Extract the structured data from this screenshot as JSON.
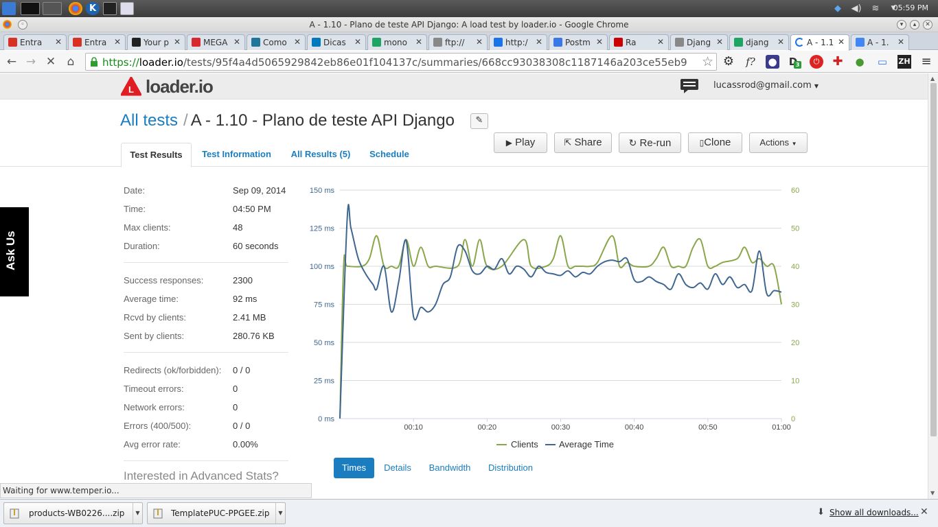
{
  "os": {
    "clock": "05:59 PM"
  },
  "window": {
    "title": "A - 1.10 - Plano de teste API Django: A load test by loader.io - Google Chrome"
  },
  "tabs": [
    {
      "label": "Entra",
      "favicon": "gmail-icon",
      "color": "#d93025"
    },
    {
      "label": "Entra",
      "favicon": "gmail-icon",
      "color": "#d93025"
    },
    {
      "label": "Your p",
      "favicon": "w-icon",
      "color": "#222222"
    },
    {
      "label": "MEGA",
      "favicon": "mega-icon",
      "color": "#d9272e"
    },
    {
      "label": "Como",
      "favicon": "wordpress-icon",
      "color": "#21759b"
    },
    {
      "label": "Dicas",
      "favicon": "trello-icon",
      "color": "#0079bf"
    },
    {
      "label": "mono",
      "favicon": "drive-icon",
      "color": "#1fa463"
    },
    {
      "label": "ftp://",
      "favicon": "page-icon",
      "color": "#888888"
    },
    {
      "label": "http:/",
      "favicon": "arrows-icon",
      "color": "#1a73e8"
    },
    {
      "label": "Postm",
      "favicon": "globe-icon",
      "color": "#3b78e7"
    },
    {
      "label": "Ra",
      "favicon": "youtube-icon",
      "color": "#cc0000"
    },
    {
      "label": "Djang",
      "favicon": "page-icon",
      "color": "#888888"
    },
    {
      "label": "djang",
      "favicon": "drive-icon",
      "color": "#1fa463"
    },
    {
      "label": "A - 1.1",
      "favicon": "loading-icon",
      "color": "#1a73e8"
    },
    {
      "label": "A - 1.",
      "favicon": "docs-icon",
      "color": "#4285f4"
    }
  ],
  "toolbar": {
    "url_protocol": "https://",
    "url_host": "loader.io",
    "url_path": "/tests/95f4a4d5065929842eb86e01f104137c/summaries/668cc93038308c1187146a203ce55eb9",
    "ext_zh": "ZH",
    "ext_f": "f?",
    "ext_d_badge": "3"
  },
  "header": {
    "logo": "loader.io",
    "user": "lucassrod@gmail.com"
  },
  "breadcrumb": {
    "all_tests": "All tests",
    "separator": "/",
    "test_name": "A - 1.10 - Plano de teste API Django"
  },
  "actions": {
    "play": "Play",
    "share": "Share",
    "rerun": "Re-run",
    "clone": "Clone",
    "actions": "Actions"
  },
  "page_tabs": {
    "results": "Test Results",
    "info": "Test Information",
    "all": "All Results (5)",
    "schedule": "Schedule"
  },
  "stats": {
    "date_label": "Date:",
    "date": "Sep 09, 2014",
    "time_label": "Time:",
    "time": "04:50 PM",
    "max_clients_label": "Max clients:",
    "max_clients": "48",
    "duration_label": "Duration:",
    "duration": "60 seconds",
    "success_label": "Success responses:",
    "success": "2300",
    "avg_label": "Average time:",
    "avg": "92 ms",
    "rcvd_label": "Rcvd by clients:",
    "rcvd": "2.41 MB",
    "sent_label": "Sent by clients:",
    "sent": "280.76 KB",
    "redirects_label": "Redirects (ok/forbidden):",
    "redirects": "0 / 0",
    "timeout_label": "Timeout errors:",
    "timeout": "0",
    "network_label": "Network errors:",
    "network": "0",
    "errors_label": "Errors (400/500):",
    "errors": "0 / 0",
    "error_rate_label": "Avg error rate:",
    "error_rate": "0.00%",
    "advanced": "Interested in Advanced Stats?"
  },
  "chart_buttons": {
    "times": "Times",
    "details": "Details",
    "bandwidth": "Bandwidth",
    "distribution": "Distribution"
  },
  "askus": "Ask Us",
  "status": "Waiting for www.temper.io...",
  "downloads": {
    "file1": "products-WB0226....zip",
    "file2": "TemplatePUC-PPGEE.zip",
    "show_all": "Show all downloads..."
  },
  "colors": {
    "link": "#1a7dbf",
    "clients": "#8aa64a",
    "avg_time": "#3e6690"
  },
  "chart_data": {
    "type": "line",
    "x_ticks": [
      "00:10",
      "00:20",
      "00:30",
      "00:40",
      "00:50",
      "01:00"
    ],
    "y_left_ticks": [
      "0 ms",
      "25 ms",
      "50 ms",
      "75 ms",
      "100 ms",
      "125 ms",
      "150 ms"
    ],
    "y_right_ticks": [
      "0",
      "10",
      "20",
      "30",
      "40",
      "50",
      "60"
    ],
    "ylim_left": [
      0,
      150
    ],
    "ylim_right": [
      0,
      60
    ],
    "xlim": [
      0,
      60
    ],
    "grid": true,
    "legend_position": "bottom",
    "series": [
      {
        "name": "Clients",
        "axis": "right",
        "color": "#8aa64a",
        "x": [
          0,
          0.5,
          1,
          3,
          4,
          5,
          6,
          7,
          8,
          9,
          10,
          11,
          12,
          13,
          16,
          17,
          18,
          19,
          20,
          22,
          25,
          26,
          28,
          29,
          30,
          31,
          32,
          33,
          34,
          35,
          37,
          38,
          39,
          40,
          42,
          43,
          44,
          45,
          46,
          47,
          48,
          49,
          50,
          51,
          52,
          54,
          55,
          56,
          57,
          58,
          59,
          60
        ],
        "y": [
          0,
          40,
          40,
          40,
          42,
          48,
          40,
          40,
          40,
          47,
          40,
          45,
          40,
          40,
          40,
          47,
          40,
          47,
          40,
          40,
          47,
          40,
          40,
          42,
          48,
          40,
          40,
          40,
          40,
          41,
          48,
          40,
          41,
          40,
          40,
          42,
          45,
          40,
          40,
          40,
          45,
          47,
          40,
          40,
          41,
          42,
          45,
          41,
          42,
          40,
          40,
          30
        ]
      },
      {
        "name": "Average Time",
        "axis": "left",
        "color": "#3e6690",
        "x": [
          0,
          1,
          1.5,
          2.5,
          3.5,
          4.5,
          5,
          6,
          7,
          8,
          9,
          10,
          11,
          12,
          13,
          14,
          15,
          16,
          17,
          18,
          19,
          20,
          21,
          22,
          23,
          24,
          25,
          26,
          27,
          28,
          29,
          30,
          31,
          32,
          33,
          34,
          35,
          36,
          37,
          38,
          39,
          40,
          41,
          42,
          43,
          44,
          45,
          46,
          47,
          48,
          49,
          50,
          51,
          52,
          53,
          54,
          55,
          56,
          57,
          58,
          59,
          60
        ],
        "y": [
          0,
          132,
          125,
          105,
          95,
          88,
          85,
          100,
          70,
          90,
          117,
          67,
          73,
          70,
          75,
          88,
          93,
          113,
          110,
          97,
          95,
          100,
          98,
          105,
          95,
          100,
          98,
          93,
          100,
          96,
          95,
          94,
          97,
          93,
          96,
          95,
          100,
          103,
          104,
          103,
          105,
          91,
          90,
          93,
          90,
          88,
          85,
          95,
          88,
          86,
          89,
          85,
          95,
          88,
          93,
          86,
          88,
          84,
          110,
          82,
          84,
          83
        ]
      }
    ]
  }
}
